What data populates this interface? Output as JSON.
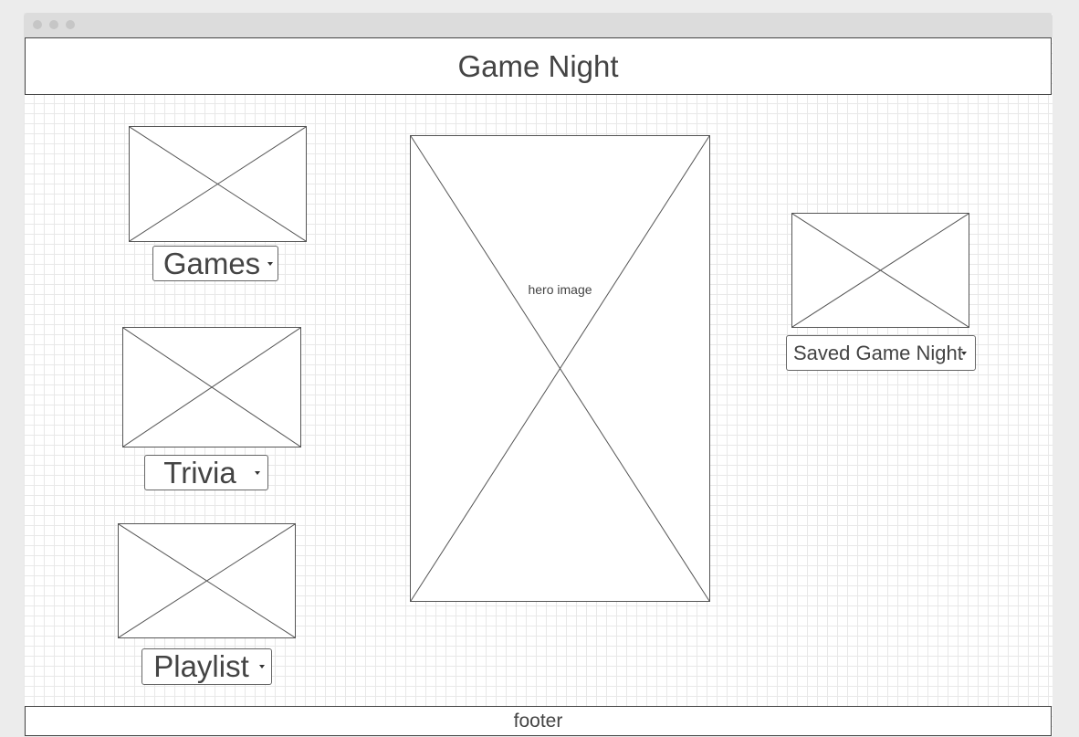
{
  "header": {
    "title": "Game Night"
  },
  "dropdowns": {
    "games": "Games",
    "trivia": "Trivia",
    "playlist": "Playlist",
    "saved": "Saved Game Night"
  },
  "hero": {
    "label": "hero image"
  },
  "footer": {
    "label": "footer"
  }
}
